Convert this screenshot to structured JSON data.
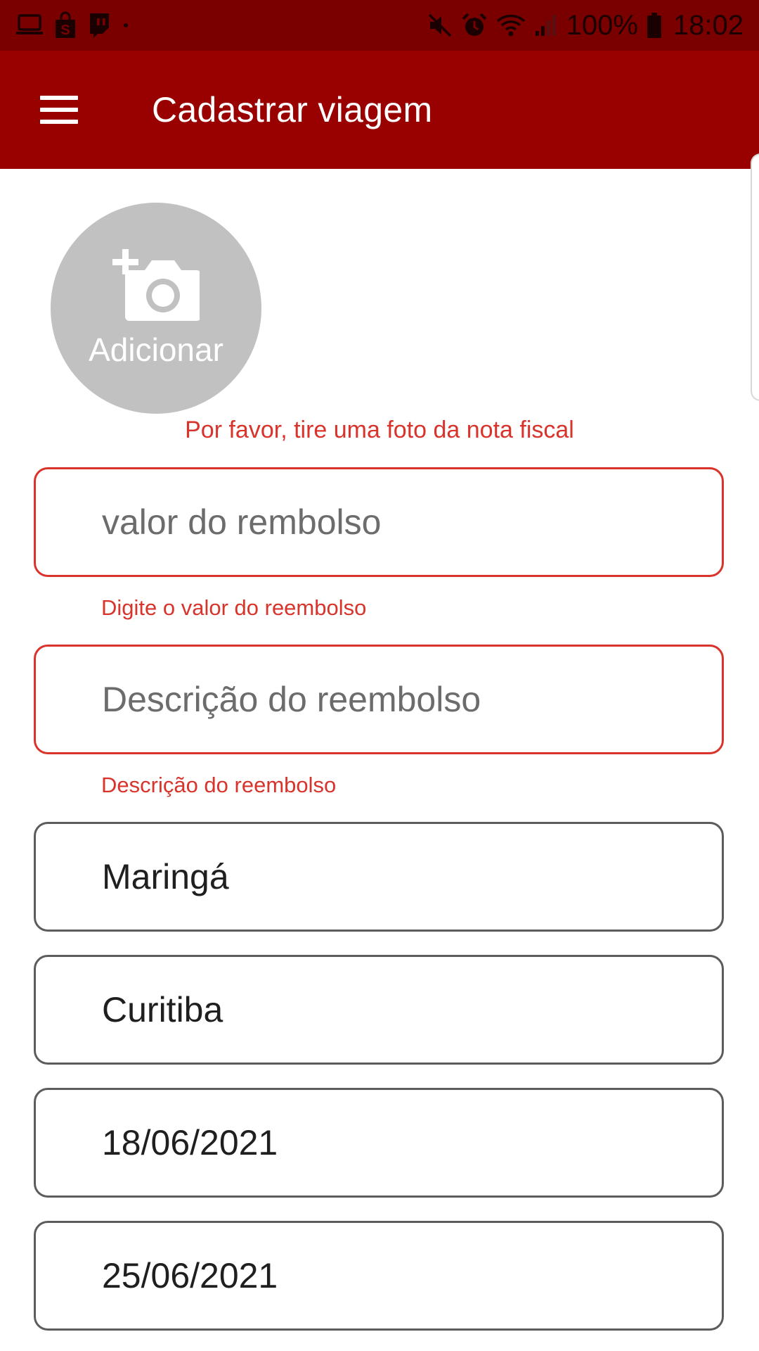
{
  "status_bar": {
    "battery_percent": "100%",
    "time": "18:02",
    "left_icons": [
      "laptop-icon",
      "shopping-bag-icon",
      "twitch-icon",
      "dot-icon"
    ],
    "right_icons": [
      "mute-icon",
      "alarm-icon",
      "wifi-icon",
      "signal-icon",
      "battery-icon"
    ]
  },
  "app_bar": {
    "title": "Cadastrar viagem",
    "menu_icon": "hamburger-menu-icon"
  },
  "photo": {
    "label": "Adicionar",
    "icon": "add-camera-icon",
    "error": "Por favor, tire uma foto da nota fiscal"
  },
  "form": {
    "valor": {
      "placeholder": "valor do rembolso",
      "value": "",
      "error": "Digite o valor do reembolso"
    },
    "descricao": {
      "placeholder": "Descrição do reembolso",
      "value": "",
      "error": "Descrição do reembolso"
    },
    "origem": {
      "value": "Maringá"
    },
    "destino": {
      "value": "Curitiba"
    },
    "data_ida": {
      "value": "18/06/2021"
    },
    "data_volta": {
      "value": "25/06/2021"
    }
  },
  "colors": {
    "status_bar": "#7a0000",
    "app_bar": "#990000",
    "error": "#d8342c",
    "field_border": "#5c5c5c",
    "photo_circle": "#c1c1c1"
  }
}
